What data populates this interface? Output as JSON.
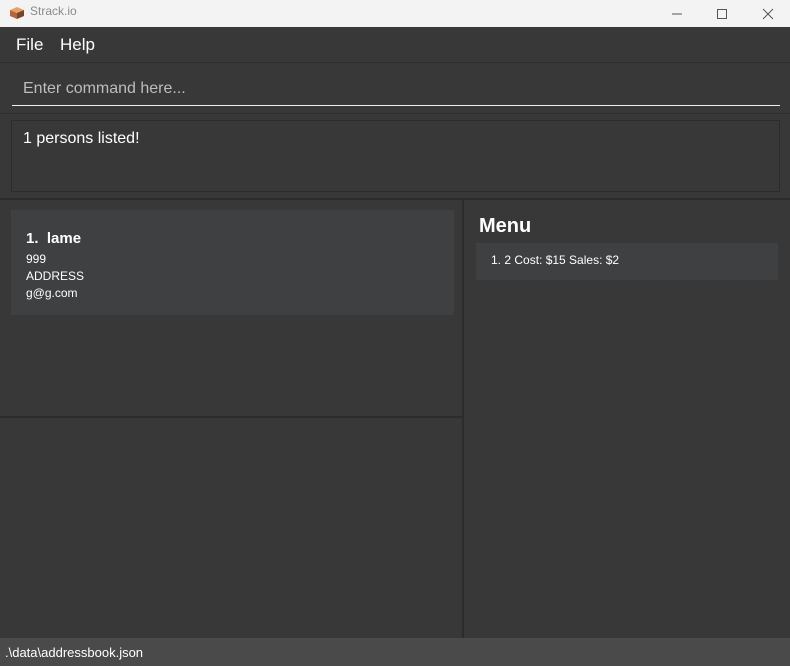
{
  "window": {
    "title": "Strack.io",
    "icon": "box-icon"
  },
  "menubar": {
    "file_label": "File",
    "help_label": "Help"
  },
  "command": {
    "placeholder": "Enter command here...",
    "value": ""
  },
  "result": {
    "message": "1 persons listed!"
  },
  "persons": [
    {
      "index": "1.",
      "name": "lame",
      "phone": "999",
      "address": "ADDRESS",
      "email": "g@g.com"
    }
  ],
  "menu_panel": {
    "heading": "Menu",
    "items": [
      {
        "text": "1. 2  Cost: $15  Sales: $2"
      }
    ]
  },
  "status": {
    "file_path": ".\\data\\addressbook.json"
  },
  "colors": {
    "background": "#383838",
    "card": "#3f4042",
    "titlebar": "#f3f3f3",
    "statusbar": "#4a4a4a",
    "text": "#ffffff"
  }
}
